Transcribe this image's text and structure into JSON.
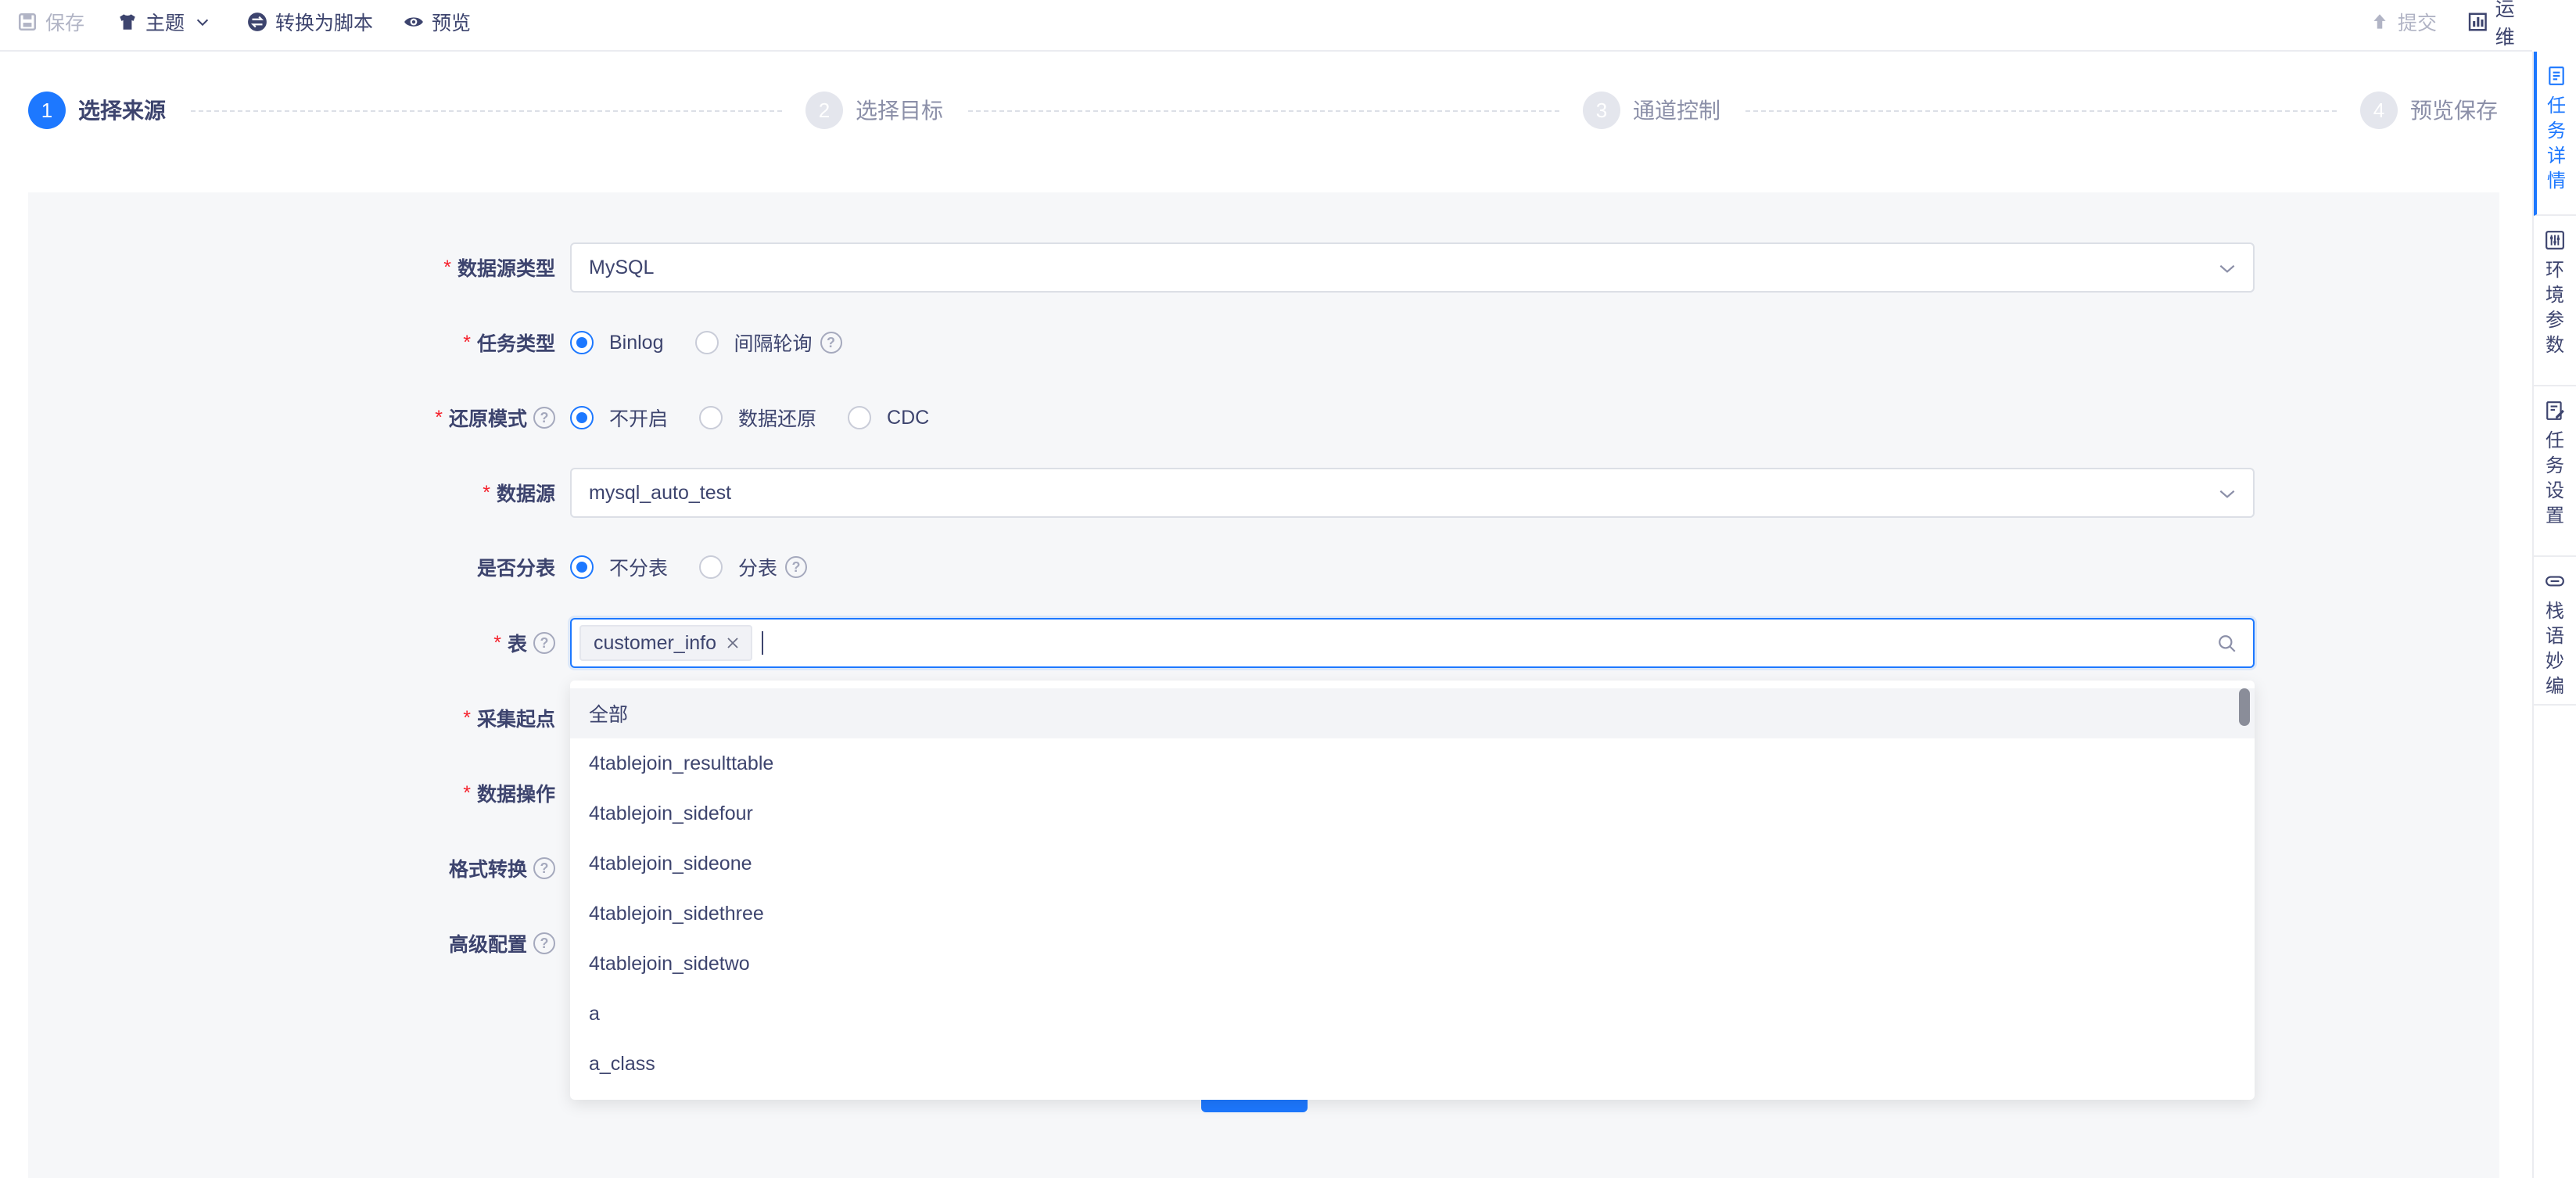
{
  "toolbar": {
    "save": "保存",
    "theme": "主题",
    "convert": "转换为脚本",
    "preview": "预览",
    "submit": "提交",
    "ops": "运维"
  },
  "side_panel": {
    "tabs": [
      "任务详情",
      "环境参数",
      "任务设置",
      "栈语妙编"
    ],
    "active_index": 0
  },
  "steps": [
    {
      "num": "1",
      "label": "选择来源",
      "state": "active"
    },
    {
      "num": "2",
      "label": "选择目标",
      "state": "wait"
    },
    {
      "num": "3",
      "label": "通道控制",
      "state": "wait"
    },
    {
      "num": "4",
      "label": "预览保存",
      "state": "wait"
    }
  ],
  "form": {
    "datasource_type": {
      "label": "数据源类型",
      "value": "MySQL"
    },
    "task_type": {
      "label": "任务类型",
      "options": [
        "Binlog",
        "间隔轮询"
      ],
      "selected": "Binlog"
    },
    "restore_mode": {
      "label": "还原模式",
      "options": [
        "不开启",
        "数据还原",
        "CDC"
      ],
      "selected": "不开启"
    },
    "datasource": {
      "label": "数据源",
      "value": "mysql_auto_test"
    },
    "sharding": {
      "label": "是否分表",
      "options": [
        "不分表",
        "分表"
      ],
      "selected": "不分表"
    },
    "table": {
      "label": "表",
      "tags": [
        "customer_info"
      ]
    },
    "collect_start": {
      "label": "采集起点"
    },
    "data_ops": {
      "label": "数据操作"
    },
    "format_convert": {
      "label": "格式转换"
    },
    "advanced": {
      "label": "高级配置"
    }
  },
  "dropdown": {
    "options": [
      "全部",
      "4tablejoin_resulttable",
      "4tablejoin_sidefour",
      "4tablejoin_sideone",
      "4tablejoin_sidethree",
      "4tablejoin_sidetwo",
      "a",
      "a_class"
    ],
    "hover_index": 0
  },
  "colors": {
    "accent": "#1d78ff",
    "required": "#f5222d",
    "text": "#3d446e",
    "panel_bg": "#f6f7f9"
  }
}
